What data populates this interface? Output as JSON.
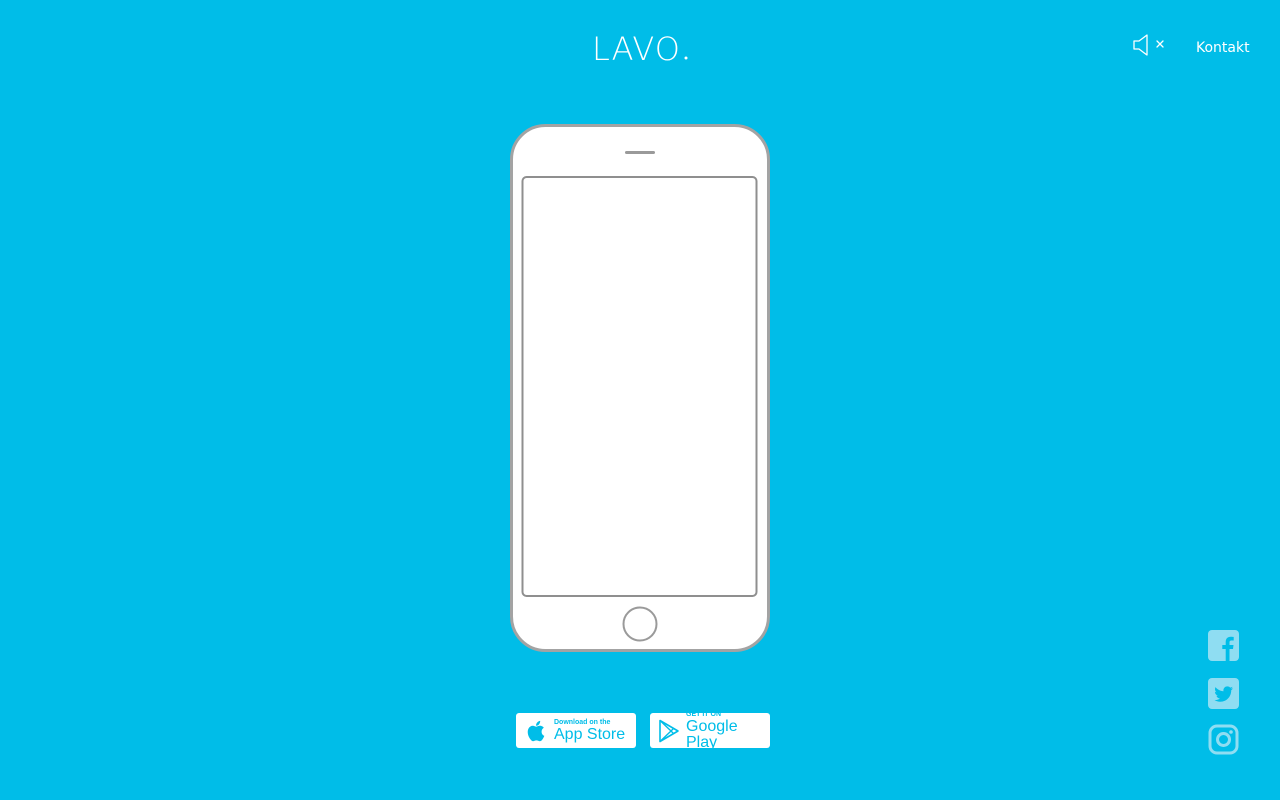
{
  "header": {
    "logo_text": "LAVO",
    "sound_icon": "speaker-muted-icon",
    "contact_label": "Kontakt"
  },
  "phone": {
    "device_icon": "smartphone-outline"
  },
  "stores": {
    "apple": {
      "small": "Download on the",
      "big": "App Store",
      "icon": "apple-icon"
    },
    "google": {
      "small": "GET IT ON",
      "big": "Google Play",
      "icon": "google-play-icon"
    }
  },
  "social": {
    "icons": [
      "facebook-icon",
      "twitter-icon",
      "instagram-icon"
    ]
  },
  "colors": {
    "background": "#00BDE8",
    "accent": "#ffffff",
    "phone_outline": "#9a9a9a",
    "social_icon": "#8FDDF2"
  }
}
